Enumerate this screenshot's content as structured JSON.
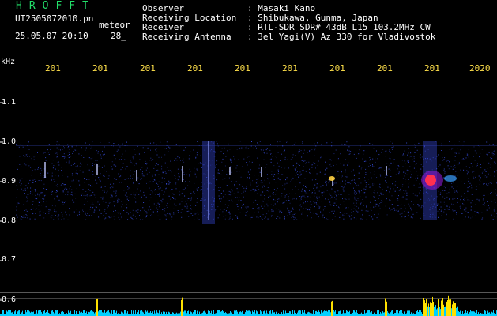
{
  "brand": "HROFFT",
  "file": {
    "name": "UT2505072010.pn",
    "meteor": "meteor",
    "datetime": "25.05.07 20:10",
    "count": "28_"
  },
  "info": {
    "labels": [
      "Observer",
      "Receiving Location",
      "Receiver",
      "Receiving Antenna"
    ],
    "values": [
      ": Masaki Kano",
      ": Shibukawa, Gunma, Japan",
      ": RTL-SDR SDR# 43dB L15 103.2MHz CW",
      ": 3el Yagi(V) Az 330 for Vladivostok"
    ]
  },
  "freq_axis": {
    "unit": "kHz",
    "ticks": [
      "1.1",
      "1.0",
      "0.9",
      "0.8",
      "0.7",
      "0.6"
    ]
  },
  "time_axis": {
    "ticks": [
      "201",
      "201",
      "201",
      "201",
      "201",
      "201",
      "201",
      "201",
      "201",
      "2020"
    ]
  },
  "colors": {
    "background": "#000000",
    "brand": "#22e06a",
    "time_ticks": "#ffe04a",
    "noise_band": "#1a2a8a",
    "echo_hot": "#ff3050",
    "histogram": "#00d0ff",
    "histogram_peak": "#ffe000"
  }
}
